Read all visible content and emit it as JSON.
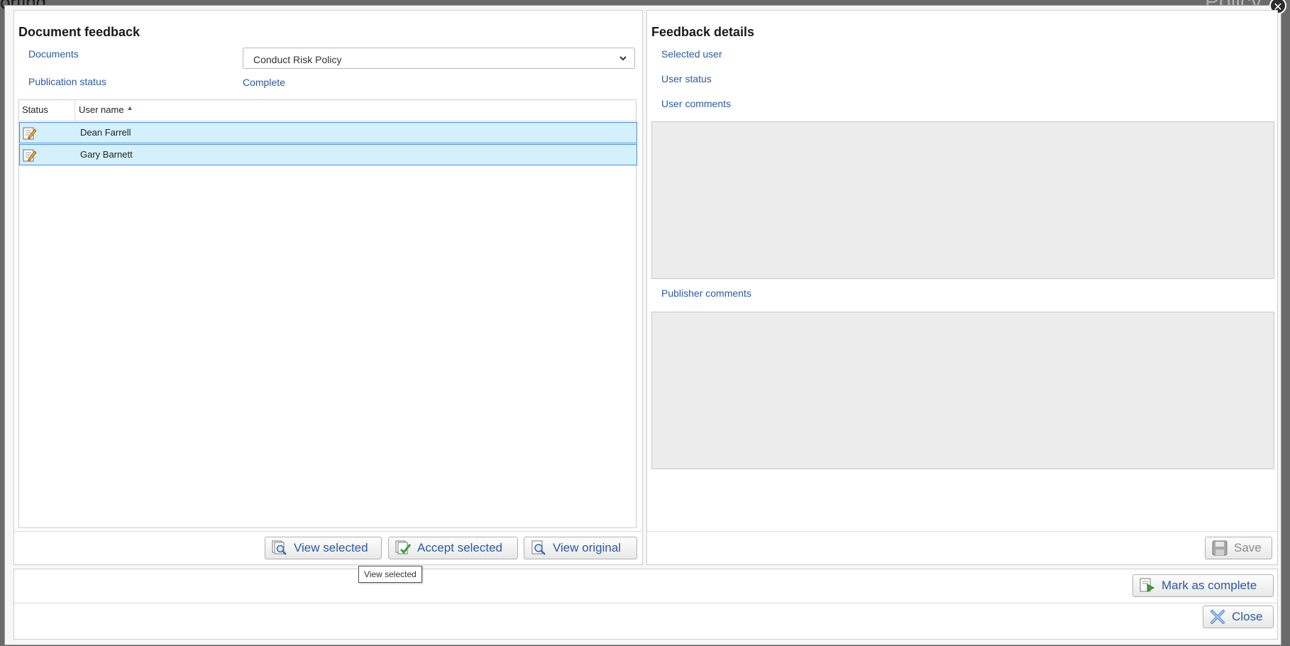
{
  "background": {
    "title_fragment": "orting",
    "logo_fragment": "Policy"
  },
  "left_panel": {
    "title": "Document feedback",
    "documents_label": "Documents",
    "documents_value": "Conduct Risk Policy",
    "publication_status_label": "Publication status",
    "publication_status_value": "Complete",
    "grid": {
      "columns": [
        "Status",
        "User name"
      ],
      "rows": [
        {
          "status_icon": "edit-document-icon",
          "user_name": "Dean Farrell"
        },
        {
          "status_icon": "edit-document-icon",
          "user_name": "Gary Barnett"
        }
      ]
    },
    "buttons": {
      "view_selected": "View selected",
      "accept_selected": "Accept selected",
      "view_original": "View original"
    }
  },
  "right_panel": {
    "title": "Feedback details",
    "selected_user_label": "Selected user",
    "user_status_label": "User status",
    "user_comments_label": "User comments",
    "publisher_comments_label": "Publisher comments",
    "buttons": {
      "save": "Save"
    }
  },
  "footer": {
    "mark_as_complete": "Mark as complete",
    "close": "Close"
  },
  "tooltip": "View selected",
  "colors": {
    "label_blue": "#2b5aa0",
    "row_selected_bg": "#d4f0fc",
    "row_selected_border": "#4a8fd6"
  }
}
